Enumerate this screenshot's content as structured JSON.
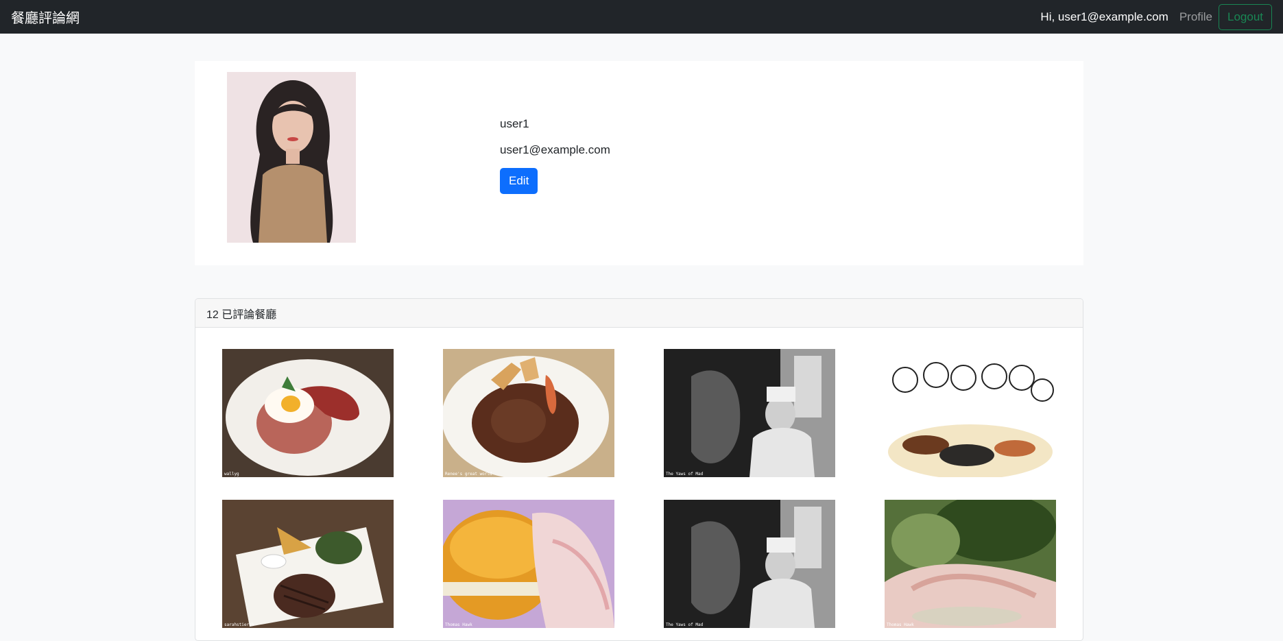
{
  "navbar": {
    "brand": "餐廳評論網",
    "greeting": "Hi, user1@example.com",
    "profile_label": "Profile",
    "logout_label": "Logout"
  },
  "profile": {
    "name": "user1",
    "email": "user1@example.com",
    "edit_label": "Edit",
    "avatar_icon": "user-photo"
  },
  "reviewed": {
    "header": "12 已評論餐廳",
    "restaurants": [
      {
        "image": "rice-egg-sausage-plate",
        "caption": "wallyg"
      },
      {
        "image": "hamburg-steak-plate",
        "caption": "Renee's great world"
      },
      {
        "image": "bw-chef-window",
        "caption": "The Yaws of Mad"
      },
      {
        "image": "sketch-diners-table",
        "caption": ""
      },
      {
        "image": "steak-fries-plate",
        "caption": "sarahstierch"
      },
      {
        "image": "bread-ham-closeup",
        "caption": "Thomas Hawk"
      },
      {
        "image": "bw-chef-window",
        "caption": "The Yaws of Mad"
      },
      {
        "image": "ham-greens-closeup",
        "caption": "Thomas Hawk"
      }
    ]
  }
}
